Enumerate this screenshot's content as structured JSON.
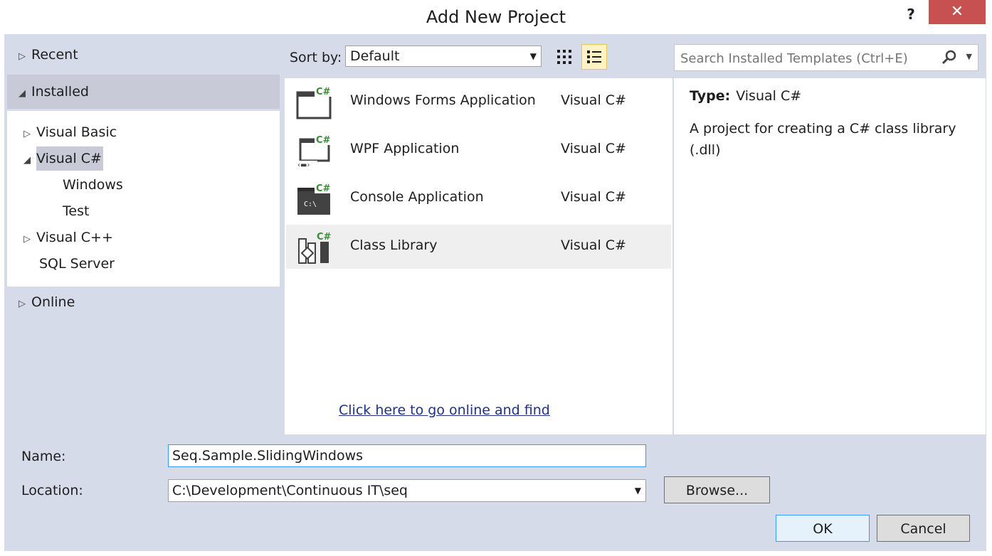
{
  "window": {
    "title": "Add New Project",
    "help_label": "?",
    "close_label": "✕"
  },
  "tree": {
    "recent": "Recent",
    "installed": "Installed",
    "visual_basic": "Visual Basic",
    "visual_csharp": "Visual C#",
    "windows": "Windows",
    "test": "Test",
    "visual_cpp": "Visual C++",
    "sql_server": "SQL Server",
    "online": "Online"
  },
  "toolbar": {
    "sort_label": "Sort by:",
    "sort_value": "Default"
  },
  "templates": [
    {
      "name": "Windows Forms Application",
      "lang": "Visual C#"
    },
    {
      "name": "WPF Application",
      "lang": "Visual C#"
    },
    {
      "name": "Console Application",
      "lang": "Visual C#"
    },
    {
      "name": "Class Library",
      "lang": "Visual C#"
    }
  ],
  "icon_badge": "C#",
  "console_glyph": "C:\\",
  "online_link": "Click here to go online and find",
  "search": {
    "placeholder": "Search Installed Templates (Ctrl+E)"
  },
  "details": {
    "type_label": "Type:",
    "type_value": "Visual C#",
    "description": "A project for creating a C# class library (.dll)"
  },
  "form": {
    "name_label": "Name:",
    "name_value": "Seq.Sample.SlidingWindows",
    "location_label": "Location:",
    "location_value": "C:\\Development\\Continuous IT\\seq",
    "browse_label": "Browse...",
    "ok_label": "OK",
    "cancel_label": "Cancel"
  },
  "colors": {
    "accent_green": "#388a34",
    "selection": "#c8cbd7",
    "body_bg": "#d6dbe9",
    "close_red": "#c75050",
    "link": "#1e3287"
  }
}
